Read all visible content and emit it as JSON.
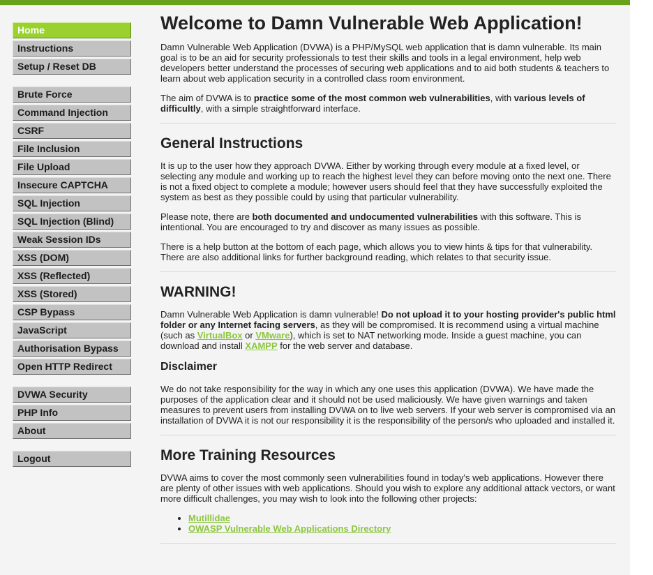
{
  "menu": {
    "group1": [
      {
        "label": "Home",
        "selected": true
      },
      {
        "label": "Instructions"
      },
      {
        "label": "Setup / Reset DB"
      }
    ],
    "group2": [
      {
        "label": "Brute Force"
      },
      {
        "label": "Command Injection"
      },
      {
        "label": "CSRF"
      },
      {
        "label": "File Inclusion"
      },
      {
        "label": "File Upload"
      },
      {
        "label": "Insecure CAPTCHA"
      },
      {
        "label": "SQL Injection"
      },
      {
        "label": "SQL Injection (Blind)"
      },
      {
        "label": "Weak Session IDs"
      },
      {
        "label": "XSS (DOM)"
      },
      {
        "label": "XSS (Reflected)"
      },
      {
        "label": "XSS (Stored)"
      },
      {
        "label": "CSP Bypass"
      },
      {
        "label": "JavaScript"
      },
      {
        "label": "Authorisation Bypass"
      },
      {
        "label": "Open HTTP Redirect"
      }
    ],
    "group3": [
      {
        "label": "DVWA Security"
      },
      {
        "label": "PHP Info"
      },
      {
        "label": "About"
      }
    ],
    "group4": [
      {
        "label": "Logout"
      }
    ]
  },
  "colors": {
    "accent": "#67a21a",
    "selected": "#9ad12f",
    "link": "#8cc63f"
  },
  "main": {
    "title": "Welcome to Damn Vulnerable Web Application!",
    "intro": "Damn Vulnerable Web Application (DVWA) is a PHP/MySQL web application that is damn vulnerable. Its main goal is to be an aid for security professionals to test their skills and tools in a legal environment, help web developers better understand the processes of securing web applications and to aid both students & teachers to learn about web application security in a controlled class room environment.",
    "aim": {
      "t1": "The aim of DVWA is to ",
      "b1": "practice some of the most common web vulnerabilities",
      "t2": ", with ",
      "b2": "various levels of difficultly",
      "t3": ", with a simple straightforward interface."
    },
    "general": {
      "heading": "General Instructions",
      "p1": "It is up to the user how they approach DVWA. Either by working through every module at a fixed level, or selecting any module and working up to reach the highest level they can before moving onto the next one. There is not a fixed object to complete a module; however users should feel that they have successfully exploited the system as best as they possible could by using that particular vulnerability.",
      "p2_t1": "Please note, there are ",
      "p2_b1": "both documented and undocumented vulnerabilities",
      "p2_t2": " with this software. This is intentional. You are encouraged to try and discover as many issues as possible.",
      "p3": "There is a help button at the bottom of each page, which allows you to view hints & tips for that vulnerability. There are also additional links for further background reading, which relates to that security issue."
    },
    "warning": {
      "heading": "WARNING!",
      "t1": "Damn Vulnerable Web Application is damn vulnerable! ",
      "b1": "Do not upload it to your hosting provider's public html folder or any Internet facing servers",
      "t2": ", as they will be compromised. It is recommend using a virtual machine (such as ",
      "link1": "VirtualBox",
      "t3": " or ",
      "link2": "VMware",
      "t4": "), which is set to NAT networking mode. Inside a guest machine, you can download and install ",
      "link3": "XAMPP",
      "t5": " for the web server and database."
    },
    "disclaimer": {
      "heading": "Disclaimer",
      "text": "We do not take responsibility for the way in which any one uses this application (DVWA). We have made the purposes of the application clear and it should not be used maliciously. We have given warnings and taken measures to prevent users from installing DVWA on to live web servers. If your web server is compromised via an installation of DVWA it is not our responsibility it is the responsibility of the person/s who uploaded and installed it."
    },
    "resources": {
      "heading": "More Training Resources",
      "text": "DVWA aims to cover the most commonly seen vulnerabilities found in today's web applications. However there are plenty of other issues with web applications. Should you wish to explore any additional attack vectors, or want more difficult challenges, you may wish to look into the following other projects:",
      "links": [
        "Mutillidae",
        "OWASP Vulnerable Web Applications Directory"
      ]
    }
  }
}
